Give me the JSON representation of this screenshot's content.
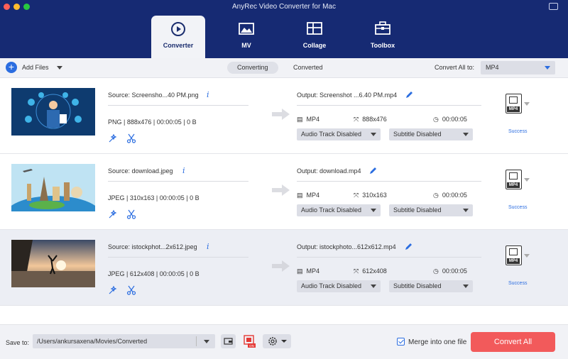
{
  "window": {
    "title": "AnyRec Video Converter for Mac"
  },
  "nav": {
    "tabs": [
      {
        "label": "Converter",
        "icon": "converter-icon",
        "active": true
      },
      {
        "label": "MV",
        "icon": "mv-icon",
        "active": false
      },
      {
        "label": "Collage",
        "icon": "collage-icon",
        "active": false
      },
      {
        "label": "Toolbox",
        "icon": "toolbox-icon",
        "active": false
      }
    ]
  },
  "toolbar": {
    "add_files": "Add Files",
    "seg_converting": "Converting",
    "seg_converted": "Converted",
    "convert_all_to": "Convert All to:",
    "format": "MP4"
  },
  "files": [
    {
      "source": "Source: Screensho...40 PM.png",
      "format": "PNG",
      "resolution": "888x476",
      "duration": "00:00:05",
      "size": "0 B",
      "output": "Output: Screenshot ...6.40 PM.mp4",
      "out_format": "MP4",
      "out_resolution": "888x476",
      "out_duration": "00:00:05",
      "audio": "Audio Track Disabled",
      "subtitle": "Subtitle Disabled",
      "badge": "MP4",
      "status": "Success"
    },
    {
      "source": "Source: download.jpeg",
      "format": "JPEG",
      "resolution": "310x163",
      "duration": "00:00:05",
      "size": "0 B",
      "output": "Output: download.mp4",
      "out_format": "MP4",
      "out_resolution": "310x163",
      "out_duration": "00:00:05",
      "audio": "Audio Track Disabled",
      "subtitle": "Subtitle Disabled",
      "badge": "MP4",
      "status": "Success"
    },
    {
      "source": "Source: istockphot...2x612.jpeg",
      "format": "JPEG",
      "resolution": "612x408",
      "duration": "00:00:05",
      "size": "0 B",
      "output": "Output: istockphoto...612x612.mp4",
      "out_format": "MP4",
      "out_resolution": "612x408",
      "out_duration": "00:00:05",
      "audio": "Audio Track Disabled",
      "subtitle": "Subtitle Disabled",
      "badge": "MP4",
      "status": "Success"
    }
  ],
  "footer": {
    "save_to": "Save to:",
    "path": "/Users/ankursaxena/Movies/Converted",
    "merge_label": "Merge into one file",
    "merge_checked": true,
    "convert_all": "Convert All",
    "hw_badge": "ON"
  },
  "colors": {
    "header_bg": "#162a73",
    "accent": "#2b6de0",
    "convert_btn": "#f25a5b",
    "status_success": "#2b6de0"
  }
}
